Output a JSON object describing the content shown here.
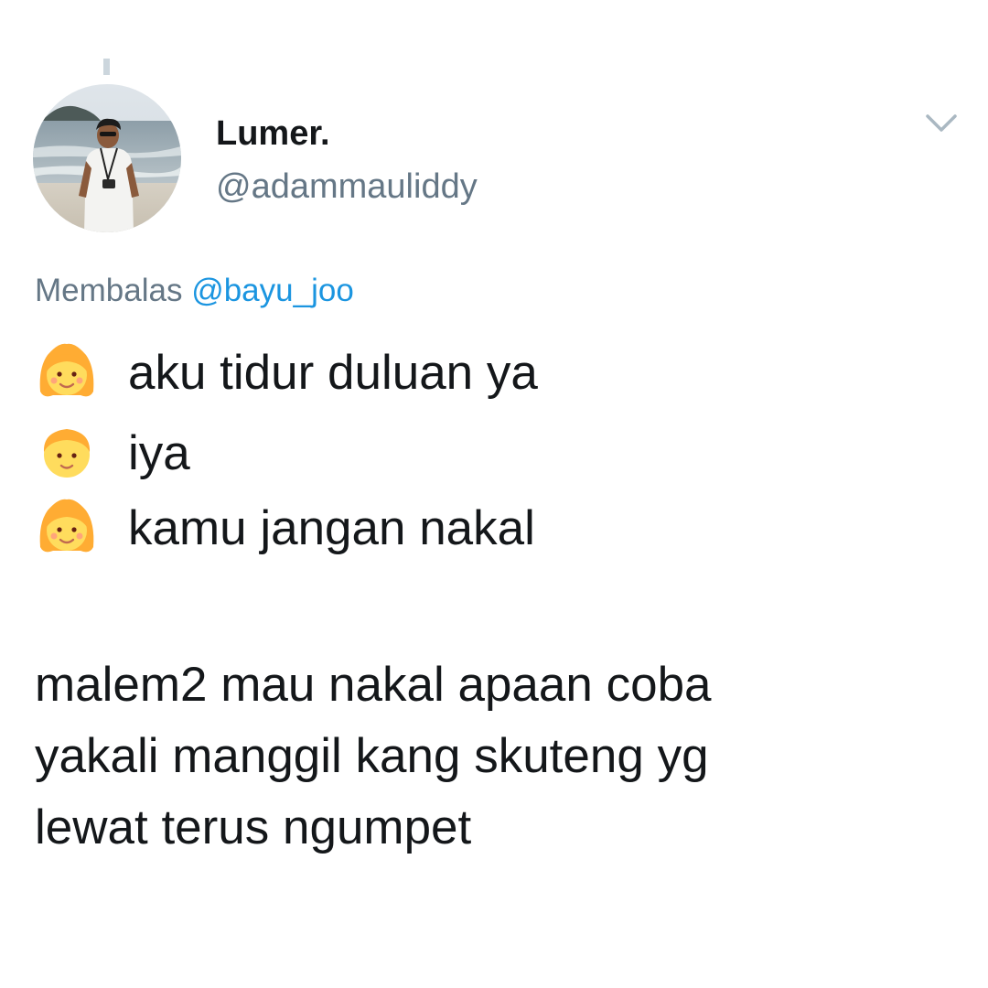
{
  "tweet": {
    "author": {
      "display_name": "Lumer.",
      "handle": "@adammauliddy",
      "avatar_icon": "avatar-photo"
    },
    "reply": {
      "prefix": "Membalas",
      "to_handle": "@bayu_joo"
    },
    "chat_lines": [
      {
        "emoji": "girl-emoji",
        "text": "aku tidur duluan ya"
      },
      {
        "emoji": "boy-emoji",
        "text": "iya"
      },
      {
        "emoji": "girl-emoji",
        "text": "kamu jangan nakal"
      }
    ],
    "body_lines": [
      "malem2 mau nakal apaan coba",
      "yakali manggil kang skuteng yg",
      "lewat terus ngumpet"
    ],
    "menu_icon": "chevron-down-icon"
  },
  "colors": {
    "text_primary": "#14171a",
    "text_secondary": "#657786",
    "link": "#1b95e0",
    "thread_line": "#ccd6dd",
    "emoji_face": "#ffdc5d",
    "emoji_hair": "#ffac33"
  }
}
